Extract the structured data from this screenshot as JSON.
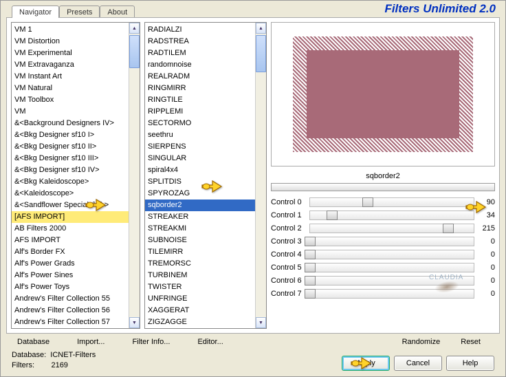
{
  "brand": "Filters Unlimited 2.0",
  "tabs": [
    {
      "label": "Navigator",
      "active": true
    },
    {
      "label": "Presets",
      "active": false
    },
    {
      "label": "About",
      "active": false
    }
  ],
  "categories": [
    "VM 1",
    "VM Distortion",
    "VM Experimental",
    "VM Extravaganza",
    "VM Instant Art",
    "VM Natural",
    "VM Toolbox",
    "VM",
    "&<Background Designers IV>",
    "&<Bkg Designer sf10 I>",
    "&<Bkg Designer sf10 II>",
    "&<Bkg Designer sf10 III>",
    "&<Bkg Designer sf10 IV>",
    "&<Bkg Kaleidoscope>",
    "&<Kaleidoscope>",
    "&<Sandflower Specials°v° >",
    "[AFS IMPORT]",
    "AB Filters 2000",
    "AFS IMPORT",
    "Alf's Border FX",
    "Alf's Power Grads",
    "Alf's Power Sines",
    "Alf's Power Toys",
    "Andrew's Filter Collection 55",
    "Andrew's Filter Collection 56",
    "Andrew's Filter Collection 57"
  ],
  "cat_highlight_index": 16,
  "filters": [
    "RADIALZI",
    "RADSTREA",
    "RADTILEM",
    "randomnoise",
    "REALRADM",
    "RINGMIRR",
    "RINGTILE",
    "RIPPLEMI",
    "SECTORMO",
    "seethru",
    "SIERPENS",
    "SINGULAR",
    "spiral4x4",
    "SPLITDIS",
    "SPYROZAG",
    "sqborder2",
    "STREAKER",
    "STREAKMI",
    "SUBNOISE",
    "TILEMIRR",
    "TREMORSC",
    "TURBINEM",
    "TWISTER",
    "UNFRINGE",
    "XAGGERAT",
    "ZIGZAGGE"
  ],
  "filter_selected_index": 15,
  "preview": {
    "label": "sqborder2"
  },
  "controls": [
    {
      "label": "Control 0",
      "value": 90
    },
    {
      "label": "Control 1",
      "value": 34
    },
    {
      "label": "Control 2",
      "value": 215
    },
    {
      "label": "Control 3",
      "value": 0
    },
    {
      "label": "Control 4",
      "value": 0
    },
    {
      "label": "Control 5",
      "value": 0
    },
    {
      "label": "Control 6",
      "value": 0
    },
    {
      "label": "Control 7",
      "value": 0
    }
  ],
  "bottom_links": {
    "database": "Database",
    "import": "Import...",
    "filter_info": "Filter Info...",
    "editor": "Editor..."
  },
  "right_links": {
    "randomize": "Randomize",
    "reset": "Reset"
  },
  "status": {
    "db_label": "Database:",
    "db_value": "ICNET-Filters",
    "filt_label": "Filters:",
    "filt_value": "2169"
  },
  "buttons": {
    "apply": "Apply",
    "cancel": "Cancel",
    "help": "Help"
  }
}
